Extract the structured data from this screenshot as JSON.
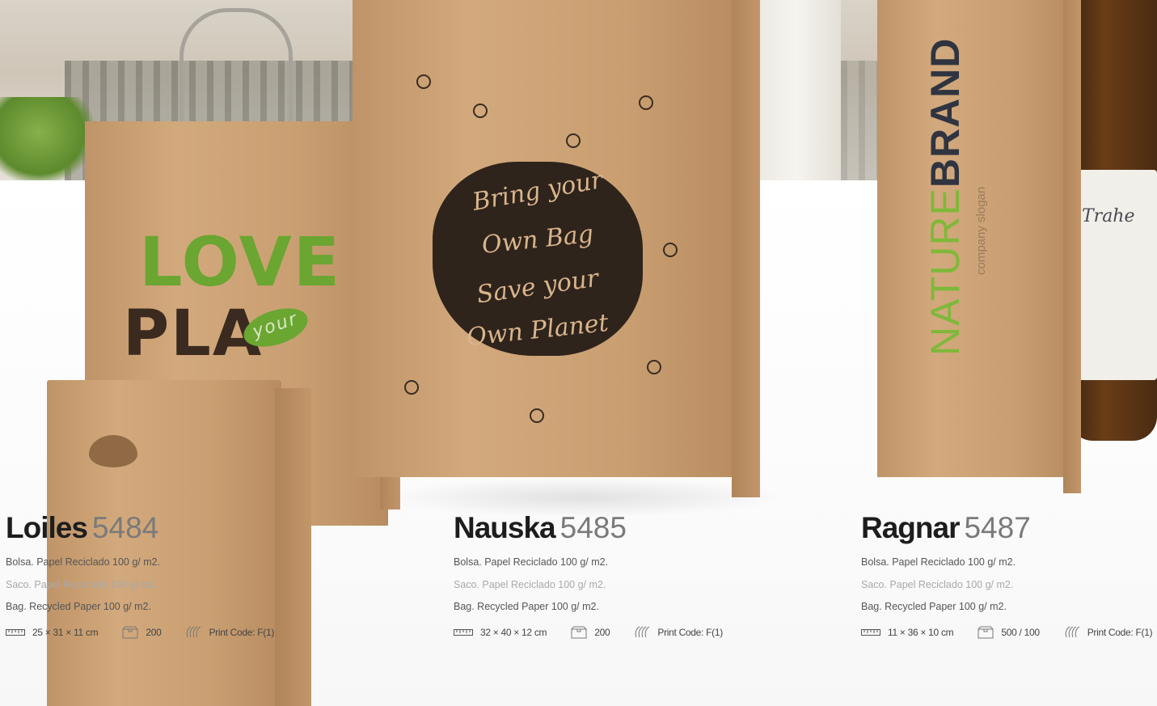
{
  "products": [
    {
      "name": "Loiles",
      "code": "5484",
      "desc_es": "Bolsa. Papel Reciclado 100 g/ m2.",
      "desc_pt": "Saco. Papel Reciclado 100 g/ m2.",
      "desc_en": "Bag. Recycled Paper 100 g/ m2.",
      "dimensions": "25 × 31 × 11 cm",
      "packaging": "200",
      "print_code": "Print Code: F(1)"
    },
    {
      "name": "Nauska",
      "code": "5485",
      "desc_es": "Bolsa. Papel Reciclado 100 g/ m2.",
      "desc_pt": "Saco. Papel Reciclado 100 g/ m2.",
      "desc_en": "Bag. Recycled Paper 100 g/ m2.",
      "dimensions": "32 × 40 × 12 cm",
      "packaging": "200",
      "print_code": "Print Code: F(1)"
    },
    {
      "name": "Ragnar",
      "code": "5487",
      "desc_es": "Bolsa. Papel Reciclado 100 g/ m2.",
      "desc_pt": "Saco. Papel Reciclado 100 g/ m2.",
      "desc_en": "Bag. Recycled Paper 100 g/ m2.",
      "dimensions": "11 × 36 × 10 cm",
      "packaging": "500 / 100",
      "print_code": "Print Code: F(1)"
    }
  ],
  "image_text": {
    "love_line1": "LOVE",
    "love_line2": "PLA",
    "love_badge": "your",
    "slogan_lines": [
      "Bring your",
      "Own Bag",
      "Save your",
      "Own Planet"
    ],
    "brand_nature": "NATURE",
    "brand_brand": "BRAND",
    "brand_slogan": "company slogan",
    "bottle_label": "Trahe"
  },
  "icons": {
    "ruler": "ruler-icon",
    "box": "box-icon",
    "print": "print-technique-icon"
  },
  "colors": {
    "kraft": "#c99f72",
    "green": "#6aa631",
    "dark_print": "#2f241c",
    "title": "#1d1d1d",
    "code": "#7a7a7a"
  }
}
